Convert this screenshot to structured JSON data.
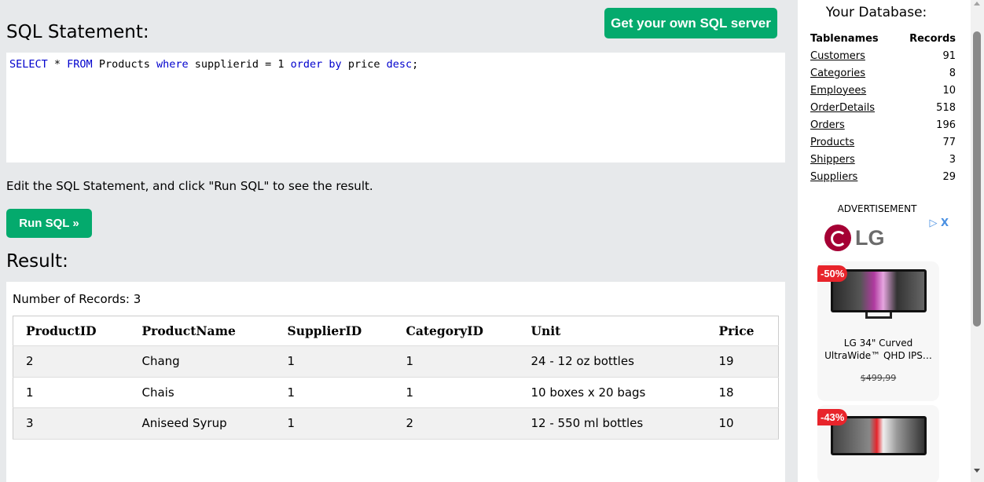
{
  "header": {
    "get_server_label": "Get your own SQL server"
  },
  "editor": {
    "heading": "SQL Statement:",
    "tokens": [
      {
        "text": "SELECT",
        "kw": true
      },
      {
        "text": " * ",
        "kw": false
      },
      {
        "text": "FROM",
        "kw": true
      },
      {
        "text": " Products ",
        "kw": false
      },
      {
        "text": "where",
        "kw": true
      },
      {
        "text": " supplierid = 1 ",
        "kw": false
      },
      {
        "text": "order by",
        "kw": true
      },
      {
        "text": " price ",
        "kw": false
      },
      {
        "text": "desc",
        "kw": true
      },
      {
        "text": ";",
        "kw": false
      }
    ]
  },
  "hint_text": "Edit the SQL Statement, and click \"Run SQL\" to see the result.",
  "run_label": "Run SQL »",
  "result": {
    "heading": "Result:",
    "count_text": "Number of Records: 3",
    "columns": [
      "ProductID",
      "ProductName",
      "SupplierID",
      "CategoryID",
      "Unit",
      "Price"
    ],
    "rows": [
      [
        "2",
        "Chang",
        "1",
        "1",
        "24 - 12 oz bottles",
        "19"
      ],
      [
        "1",
        "Chais",
        "1",
        "1",
        "10 boxes x 20 bags",
        "18"
      ],
      [
        "3",
        "Aniseed Syrup",
        "1",
        "2",
        "12 - 550 ml bottles",
        "10"
      ]
    ]
  },
  "sidebar": {
    "title": "Your Database:",
    "col_tablenames": "Tablenames",
    "col_records": "Records",
    "tables": [
      {
        "name": "Customers",
        "records": "91"
      },
      {
        "name": "Categories",
        "records": "8"
      },
      {
        "name": "Employees",
        "records": "10"
      },
      {
        "name": "OrderDetails",
        "records": "518"
      },
      {
        "name": "Orders",
        "records": "196"
      },
      {
        "name": "Products",
        "records": "77"
      },
      {
        "name": "Shippers",
        "records": "3"
      },
      {
        "name": "Suppliers",
        "records": "29"
      }
    ],
    "ad_label": "ADVERTISEMENT",
    "ad": {
      "brand": "LG",
      "controls": "▷ X",
      "product1": {
        "badge": "-50%",
        "name": "LG 34\" Curved UltraWide™ QHD IPS…",
        "price": "$499,99"
      },
      "product2": {
        "badge": "-43%"
      }
    }
  },
  "colors": {
    "accent": "#04aa6d",
    "keyword": "#0000cd",
    "background": "#e7e9eb"
  }
}
